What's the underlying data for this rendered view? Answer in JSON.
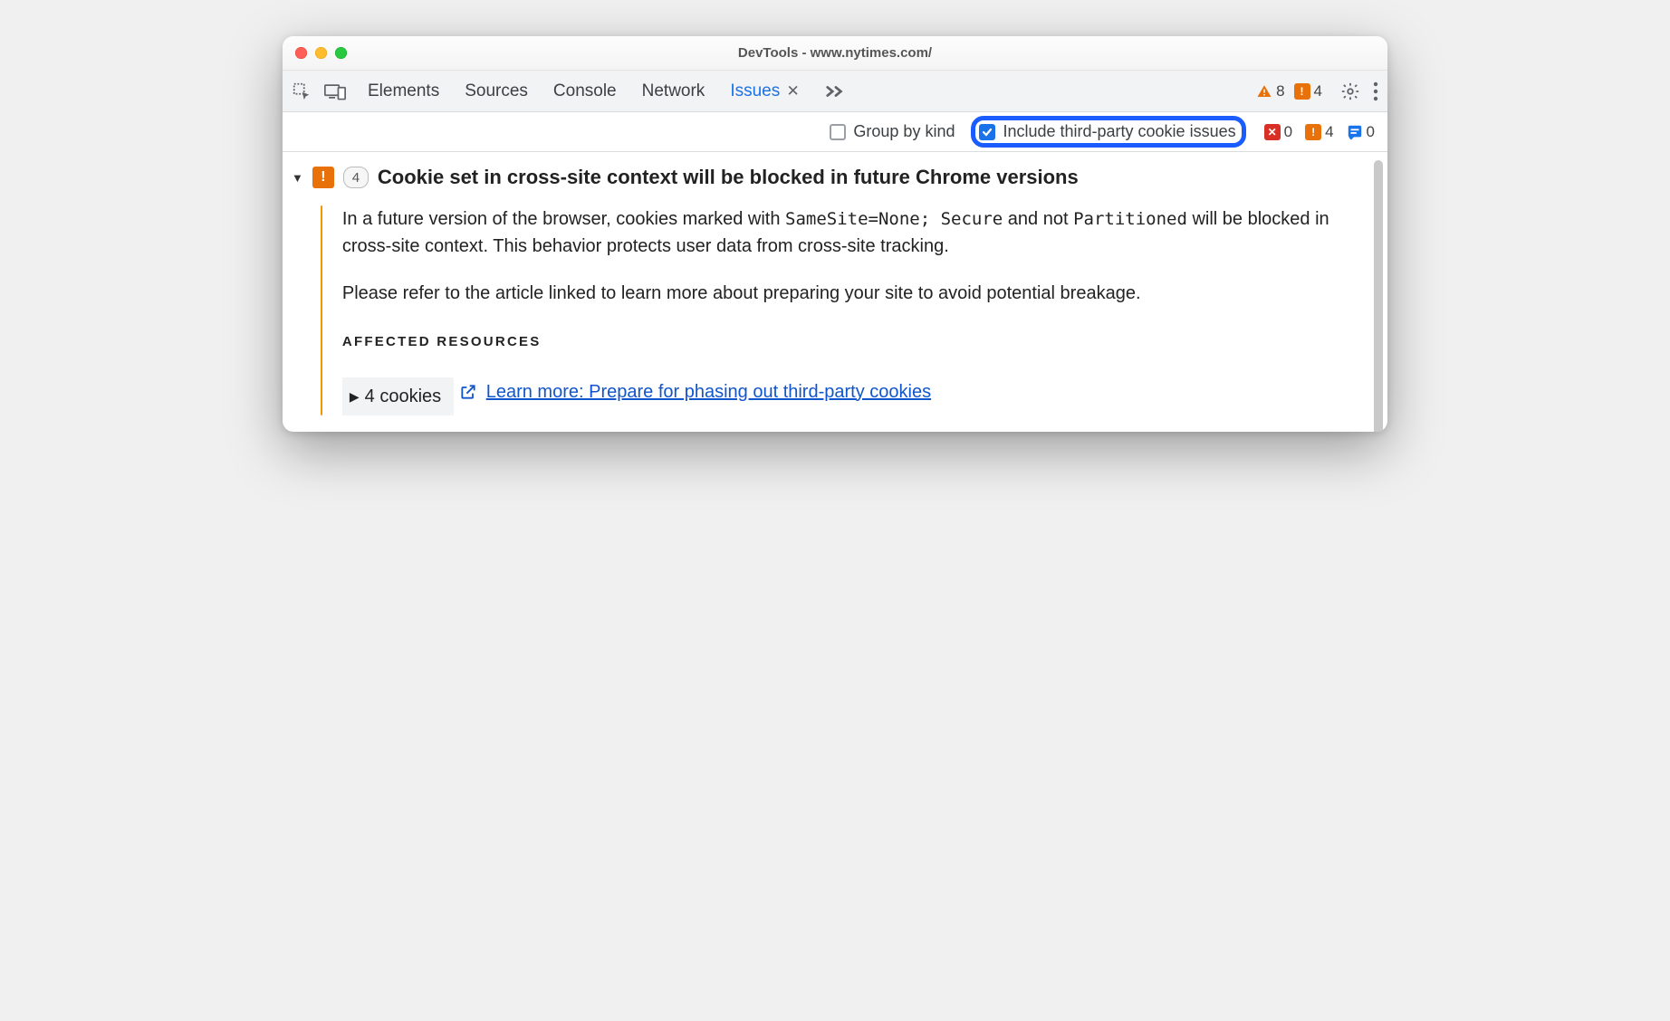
{
  "window": {
    "title": "DevTools - www.nytimes.com/"
  },
  "toolbar": {
    "tabs": [
      {
        "label": "Elements"
      },
      {
        "label": "Sources"
      },
      {
        "label": "Console"
      },
      {
        "label": "Network"
      },
      {
        "label": "Issues",
        "active": true
      }
    ],
    "warning_count": "8",
    "breaking_count": "4"
  },
  "filterbar": {
    "group_by_kind": {
      "label": "Group by kind",
      "checked": false
    },
    "include_third_party": {
      "label": "Include third-party cookie issues",
      "checked": true
    },
    "counts": {
      "errors": "0",
      "breaking": "4",
      "info": "0"
    }
  },
  "issue": {
    "count": "4",
    "title": "Cookie set in cross-site context will be blocked in future Chrome versions",
    "body_para1_a": "In a future version of the browser, cookies marked with ",
    "body_code1": "SameSite=None; Secure",
    "body_para1_b": " and not ",
    "body_code2": "Partitioned",
    "body_para1_c": " will be blocked in cross-site context. This behavior protects user data from cross-site tracking.",
    "body_para2": "Please refer to the article linked to learn more about preparing your site to avoid potential breakage.",
    "affected_label": "AFFECTED RESOURCES",
    "cookies_chip": "4 cookies",
    "learn_more": "Learn more: Prepare for phasing out third-party cookies"
  }
}
